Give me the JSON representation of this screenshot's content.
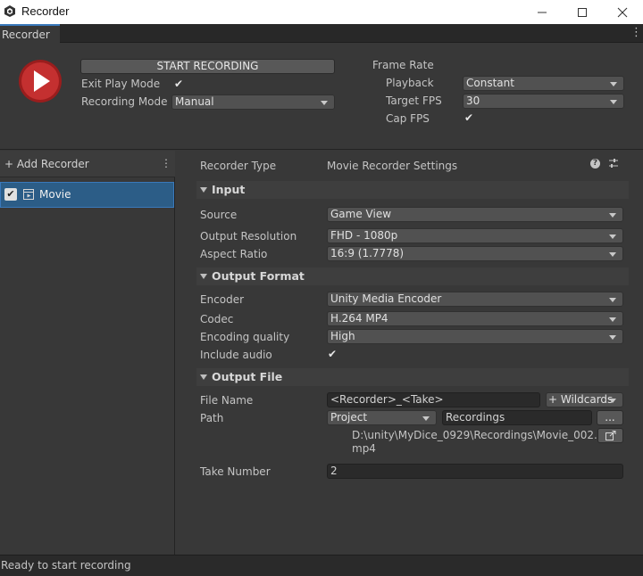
{
  "window": {
    "title": "Recorder"
  },
  "tab": {
    "label": "Recorder"
  },
  "top": {
    "start_button": "START RECORDING",
    "exit_play_mode_label": "Exit Play Mode",
    "exit_play_mode_checked": "✔",
    "recording_mode_label": "Recording Mode",
    "recording_mode_value": "Manual",
    "frame_rate_label": "Frame Rate",
    "playback_label": "Playback",
    "playback_value": "Constant",
    "target_fps_label": "Target FPS",
    "target_fps_value": "30",
    "cap_fps_label": "Cap FPS",
    "cap_fps_checked": "✔"
  },
  "sidebar": {
    "add_recorder": "+ Add Recorder",
    "menu_icon": "⋮",
    "items": [
      {
        "label": "Movie",
        "checked": "✔"
      }
    ]
  },
  "settings": {
    "recorder_type_label": "Recorder Type",
    "recorder_type_value": "Movie Recorder Settings",
    "help_icon": "?",
    "preset_icon": "⇄",
    "input": {
      "header": "Input",
      "source_label": "Source",
      "source_value": "Game View",
      "resolution_label": "Output Resolution",
      "resolution_value": "FHD - 1080p",
      "aspect_label": "Aspect Ratio",
      "aspect_value": "16:9 (1.7778)"
    },
    "output_format": {
      "header": "Output Format",
      "encoder_label": "Encoder",
      "encoder_value": "Unity Media Encoder",
      "codec_label": "Codec",
      "codec_value": "H.264 MP4",
      "quality_label": "Encoding quality",
      "quality_value": "High",
      "audio_label": "Include audio",
      "audio_checked": "✔"
    },
    "output_file": {
      "header": "Output File",
      "file_name_label": "File Name",
      "file_name_value": "<Recorder>_<Take>",
      "wildcards_button": "+ Wildcards",
      "path_label": "Path",
      "path_root_value": "Project",
      "path_value": "Recordings",
      "browse_button": "...",
      "full_path_line1": "D:\\unity\\MyDice_0929\\Recordings\\Movie_002.",
      "full_path_line2": "mp4",
      "take_number_label": "Take Number",
      "take_number_value": "2"
    }
  },
  "status": {
    "text": "Ready to start recording"
  }
}
